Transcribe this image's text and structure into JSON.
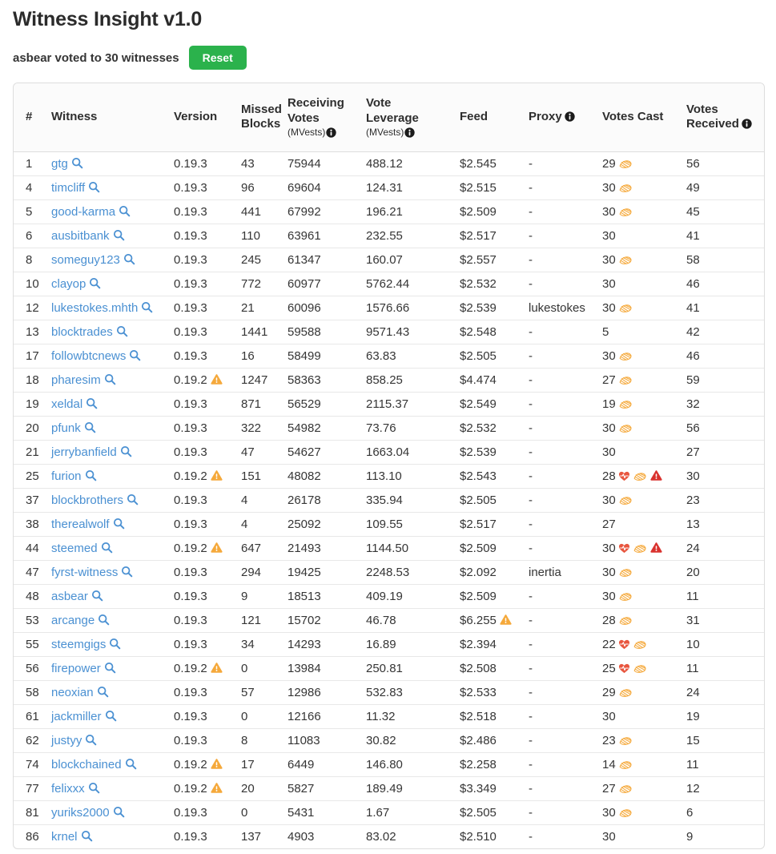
{
  "page": {
    "title": "Witness Insight v1.0",
    "status_text": "asbear voted to 30 witnesses",
    "reset_label": "Reset"
  },
  "colors": {
    "link": "#4a90d2",
    "green": "#2bb24c",
    "gold": "#f5a93b",
    "red": "#d9322e",
    "heart": "#e8563f",
    "info": "#1b1b1b",
    "text": "#353535",
    "border": "#dddddd",
    "rowline": "#e8e8e8"
  },
  "icons": {
    "search": "search-icon",
    "info": "info-icon",
    "warning": "warning-triangle-icon",
    "heart": "heartbeat-icon",
    "handshake": "handshake-icon"
  },
  "table": {
    "columns": [
      {
        "key": "rank",
        "label": "#",
        "width": 39
      },
      {
        "key": "witness",
        "label": "Witness",
        "width": 153
      },
      {
        "key": "version",
        "label": "Version",
        "width": 84
      },
      {
        "key": "missed_blocks",
        "label": "Missed Blocks",
        "width": 58
      },
      {
        "key": "receiving_votes",
        "label": "Receiving Votes",
        "sub": "(MVests)",
        "info": true,
        "width": 98
      },
      {
        "key": "vote_leverage",
        "label": "Vote Leverage",
        "sub": "(MVests)",
        "info": true,
        "width": 117
      },
      {
        "key": "feed",
        "label": "Feed",
        "width": 86
      },
      {
        "key": "proxy",
        "label": "Proxy",
        "info": true,
        "width": 92
      },
      {
        "key": "votes_cast",
        "label": "Votes Cast",
        "width": 105
      },
      {
        "key": "votes_received",
        "label": "Votes Received",
        "info": true,
        "width": 107
      }
    ],
    "rows": [
      {
        "rank": "1",
        "witness": "gtg",
        "version": "0.19.3",
        "version_warning": false,
        "missed_blocks": "43",
        "receiving_votes": "75944",
        "vote_leverage": "488.12",
        "feed": "$2.545",
        "feed_warning": false,
        "proxy": "-",
        "votes_cast": "29",
        "cast_icons": [
          "handshake"
        ],
        "votes_received": "56"
      },
      {
        "rank": "4",
        "witness": "timcliff",
        "version": "0.19.3",
        "version_warning": false,
        "missed_blocks": "96",
        "receiving_votes": "69604",
        "vote_leverage": "124.31",
        "feed": "$2.515",
        "feed_warning": false,
        "proxy": "-",
        "votes_cast": "30",
        "cast_icons": [
          "handshake"
        ],
        "votes_received": "49"
      },
      {
        "rank": "5",
        "witness": "good-karma",
        "version": "0.19.3",
        "version_warning": false,
        "missed_blocks": "441",
        "receiving_votes": "67992",
        "vote_leverage": "196.21",
        "feed": "$2.509",
        "feed_warning": false,
        "proxy": "-",
        "votes_cast": "30",
        "cast_icons": [
          "handshake"
        ],
        "votes_received": "45"
      },
      {
        "rank": "6",
        "witness": "ausbitbank",
        "version": "0.19.3",
        "version_warning": false,
        "missed_blocks": "110",
        "receiving_votes": "63961",
        "vote_leverage": "232.55",
        "feed": "$2.517",
        "feed_warning": false,
        "proxy": "-",
        "votes_cast": "30",
        "cast_icons": [],
        "votes_received": "41"
      },
      {
        "rank": "8",
        "witness": "someguy123",
        "version": "0.19.3",
        "version_warning": false,
        "missed_blocks": "245",
        "receiving_votes": "61347",
        "vote_leverage": "160.07",
        "feed": "$2.557",
        "feed_warning": false,
        "proxy": "-",
        "votes_cast": "30",
        "cast_icons": [
          "handshake"
        ],
        "votes_received": "58"
      },
      {
        "rank": "10",
        "witness": "clayop",
        "version": "0.19.3",
        "version_warning": false,
        "missed_blocks": "772",
        "receiving_votes": "60977",
        "vote_leverage": "5762.44",
        "feed": "$2.532",
        "feed_warning": false,
        "proxy": "-",
        "votes_cast": "30",
        "cast_icons": [],
        "votes_received": "46"
      },
      {
        "rank": "12",
        "witness": "lukestokes.mhth",
        "version": "0.19.3",
        "version_warning": false,
        "missed_blocks": "21",
        "receiving_votes": "60096",
        "vote_leverage": "1576.66",
        "feed": "$2.539",
        "feed_warning": false,
        "proxy": "lukestokes",
        "votes_cast": "30",
        "cast_icons": [
          "handshake"
        ],
        "votes_received": "41"
      },
      {
        "rank": "13",
        "witness": "blocktrades",
        "version": "0.19.3",
        "version_warning": false,
        "missed_blocks": "1441",
        "receiving_votes": "59588",
        "vote_leverage": "9571.43",
        "feed": "$2.548",
        "feed_warning": false,
        "proxy": "-",
        "votes_cast": "5",
        "cast_icons": [],
        "votes_received": "42"
      },
      {
        "rank": "17",
        "witness": "followbtcnews",
        "version": "0.19.3",
        "version_warning": false,
        "missed_blocks": "16",
        "receiving_votes": "58499",
        "vote_leverage": "63.83",
        "feed": "$2.505",
        "feed_warning": false,
        "proxy": "-",
        "votes_cast": "30",
        "cast_icons": [
          "handshake"
        ],
        "votes_received": "46"
      },
      {
        "rank": "18",
        "witness": "pharesim",
        "version": "0.19.2",
        "version_warning": true,
        "missed_blocks": "1247",
        "receiving_votes": "58363",
        "vote_leverage": "858.25",
        "feed": "$4.474",
        "feed_warning": false,
        "proxy": "-",
        "votes_cast": "27",
        "cast_icons": [
          "handshake"
        ],
        "votes_received": "59"
      },
      {
        "rank": "19",
        "witness": "xeldal",
        "version": "0.19.3",
        "version_warning": false,
        "missed_blocks": "871",
        "receiving_votes": "56529",
        "vote_leverage": "2115.37",
        "feed": "$2.549",
        "feed_warning": false,
        "proxy": "-",
        "votes_cast": "19",
        "cast_icons": [
          "handshake"
        ],
        "votes_received": "32"
      },
      {
        "rank": "20",
        "witness": "pfunk",
        "version": "0.19.3",
        "version_warning": false,
        "missed_blocks": "322",
        "receiving_votes": "54982",
        "vote_leverage": "73.76",
        "feed": "$2.532",
        "feed_warning": false,
        "proxy": "-",
        "votes_cast": "30",
        "cast_icons": [
          "handshake"
        ],
        "votes_received": "56"
      },
      {
        "rank": "21",
        "witness": "jerrybanfield",
        "version": "0.19.3",
        "version_warning": false,
        "missed_blocks": "47",
        "receiving_votes": "54627",
        "vote_leverage": "1663.04",
        "feed": "$2.539",
        "feed_warning": false,
        "proxy": "-",
        "votes_cast": "30",
        "cast_icons": [],
        "votes_received": "27"
      },
      {
        "rank": "25",
        "witness": "furion",
        "version": "0.19.2",
        "version_warning": true,
        "missed_blocks": "151",
        "receiving_votes": "48082",
        "vote_leverage": "113.10",
        "feed": "$2.543",
        "feed_warning": false,
        "proxy": "-",
        "votes_cast": "28",
        "cast_icons": [
          "heart",
          "handshake",
          "warning"
        ],
        "votes_received": "30"
      },
      {
        "rank": "37",
        "witness": "blockbrothers",
        "version": "0.19.3",
        "version_warning": false,
        "missed_blocks": "4",
        "receiving_votes": "26178",
        "vote_leverage": "335.94",
        "feed": "$2.505",
        "feed_warning": false,
        "proxy": "-",
        "votes_cast": "30",
        "cast_icons": [
          "handshake"
        ],
        "votes_received": "23"
      },
      {
        "rank": "38",
        "witness": "therealwolf",
        "version": "0.19.3",
        "version_warning": false,
        "missed_blocks": "4",
        "receiving_votes": "25092",
        "vote_leverage": "109.55",
        "feed": "$2.517",
        "feed_warning": false,
        "proxy": "-",
        "votes_cast": "27",
        "cast_icons": [],
        "votes_received": "13"
      },
      {
        "rank": "44",
        "witness": "steemed",
        "version": "0.19.2",
        "version_warning": true,
        "missed_blocks": "647",
        "receiving_votes": "21493",
        "vote_leverage": "1144.50",
        "feed": "$2.509",
        "feed_warning": false,
        "proxy": "-",
        "votes_cast": "30",
        "cast_icons": [
          "heart",
          "handshake",
          "warning"
        ],
        "votes_received": "24"
      },
      {
        "rank": "47",
        "witness": "fyrst-witness",
        "version": "0.19.3",
        "version_warning": false,
        "missed_blocks": "294",
        "receiving_votes": "19425",
        "vote_leverage": "2248.53",
        "feed": "$2.092",
        "feed_warning": false,
        "proxy": "inertia",
        "votes_cast": "30",
        "cast_icons": [
          "handshake"
        ],
        "votes_received": "20"
      },
      {
        "rank": "48",
        "witness": "asbear",
        "version": "0.19.3",
        "version_warning": false,
        "missed_blocks": "9",
        "receiving_votes": "18513",
        "vote_leverage": "409.19",
        "feed": "$2.509",
        "feed_warning": false,
        "proxy": "-",
        "votes_cast": "30",
        "cast_icons": [
          "handshake"
        ],
        "votes_received": "11"
      },
      {
        "rank": "53",
        "witness": "arcange",
        "version": "0.19.3",
        "version_warning": false,
        "missed_blocks": "121",
        "receiving_votes": "15702",
        "vote_leverage": "46.78",
        "feed": "$6.255",
        "feed_warning": true,
        "proxy": "-",
        "votes_cast": "28",
        "cast_icons": [
          "handshake"
        ],
        "votes_received": "31"
      },
      {
        "rank": "55",
        "witness": "steemgigs",
        "version": "0.19.3",
        "version_warning": false,
        "missed_blocks": "34",
        "receiving_votes": "14293",
        "vote_leverage": "16.89",
        "feed": "$2.394",
        "feed_warning": false,
        "proxy": "-",
        "votes_cast": "22",
        "cast_icons": [
          "heart",
          "handshake"
        ],
        "votes_received": "10"
      },
      {
        "rank": "56",
        "witness": "firepower",
        "version": "0.19.2",
        "version_warning": true,
        "missed_blocks": "0",
        "receiving_votes": "13984",
        "vote_leverage": "250.81",
        "feed": "$2.508",
        "feed_warning": false,
        "proxy": "-",
        "votes_cast": "25",
        "cast_icons": [
          "heart",
          "handshake"
        ],
        "votes_received": "11"
      },
      {
        "rank": "58",
        "witness": "neoxian",
        "version": "0.19.3",
        "version_warning": false,
        "missed_blocks": "57",
        "receiving_votes": "12986",
        "vote_leverage": "532.83",
        "feed": "$2.533",
        "feed_warning": false,
        "proxy": "-",
        "votes_cast": "29",
        "cast_icons": [
          "handshake"
        ],
        "votes_received": "24"
      },
      {
        "rank": "61",
        "witness": "jackmiller",
        "version": "0.19.3",
        "version_warning": false,
        "missed_blocks": "0",
        "receiving_votes": "12166",
        "vote_leverage": "11.32",
        "feed": "$2.518",
        "feed_warning": false,
        "proxy": "-",
        "votes_cast": "30",
        "cast_icons": [],
        "votes_received": "19"
      },
      {
        "rank": "62",
        "witness": "justyy",
        "version": "0.19.3",
        "version_warning": false,
        "missed_blocks": "8",
        "receiving_votes": "11083",
        "vote_leverage": "30.82",
        "feed": "$2.486",
        "feed_warning": false,
        "proxy": "-",
        "votes_cast": "23",
        "cast_icons": [
          "handshake"
        ],
        "votes_received": "15"
      },
      {
        "rank": "74",
        "witness": "blockchained",
        "version": "0.19.2",
        "version_warning": true,
        "missed_blocks": "17",
        "receiving_votes": "6449",
        "vote_leverage": "146.80",
        "feed": "$2.258",
        "feed_warning": false,
        "proxy": "-",
        "votes_cast": "14",
        "cast_icons": [
          "handshake"
        ],
        "votes_received": "11"
      },
      {
        "rank": "77",
        "witness": "felixxx",
        "version": "0.19.2",
        "version_warning": true,
        "missed_blocks": "20",
        "receiving_votes": "5827",
        "vote_leverage": "189.49",
        "feed": "$3.349",
        "feed_warning": false,
        "proxy": "-",
        "votes_cast": "27",
        "cast_icons": [
          "handshake"
        ],
        "votes_received": "12"
      },
      {
        "rank": "81",
        "witness": "yuriks2000",
        "version": "0.19.3",
        "version_warning": false,
        "missed_blocks": "0",
        "receiving_votes": "5431",
        "vote_leverage": "1.67",
        "feed": "$2.505",
        "feed_warning": false,
        "proxy": "-",
        "votes_cast": "30",
        "cast_icons": [
          "handshake"
        ],
        "votes_received": "6"
      },
      {
        "rank": "86",
        "witness": "krnel",
        "version": "0.19.3",
        "version_warning": false,
        "missed_blocks": "137",
        "receiving_votes": "4903",
        "vote_leverage": "83.02",
        "feed": "$2.510",
        "feed_warning": false,
        "proxy": "-",
        "votes_cast": "30",
        "cast_icons": [],
        "votes_received": "9"
      }
    ]
  }
}
